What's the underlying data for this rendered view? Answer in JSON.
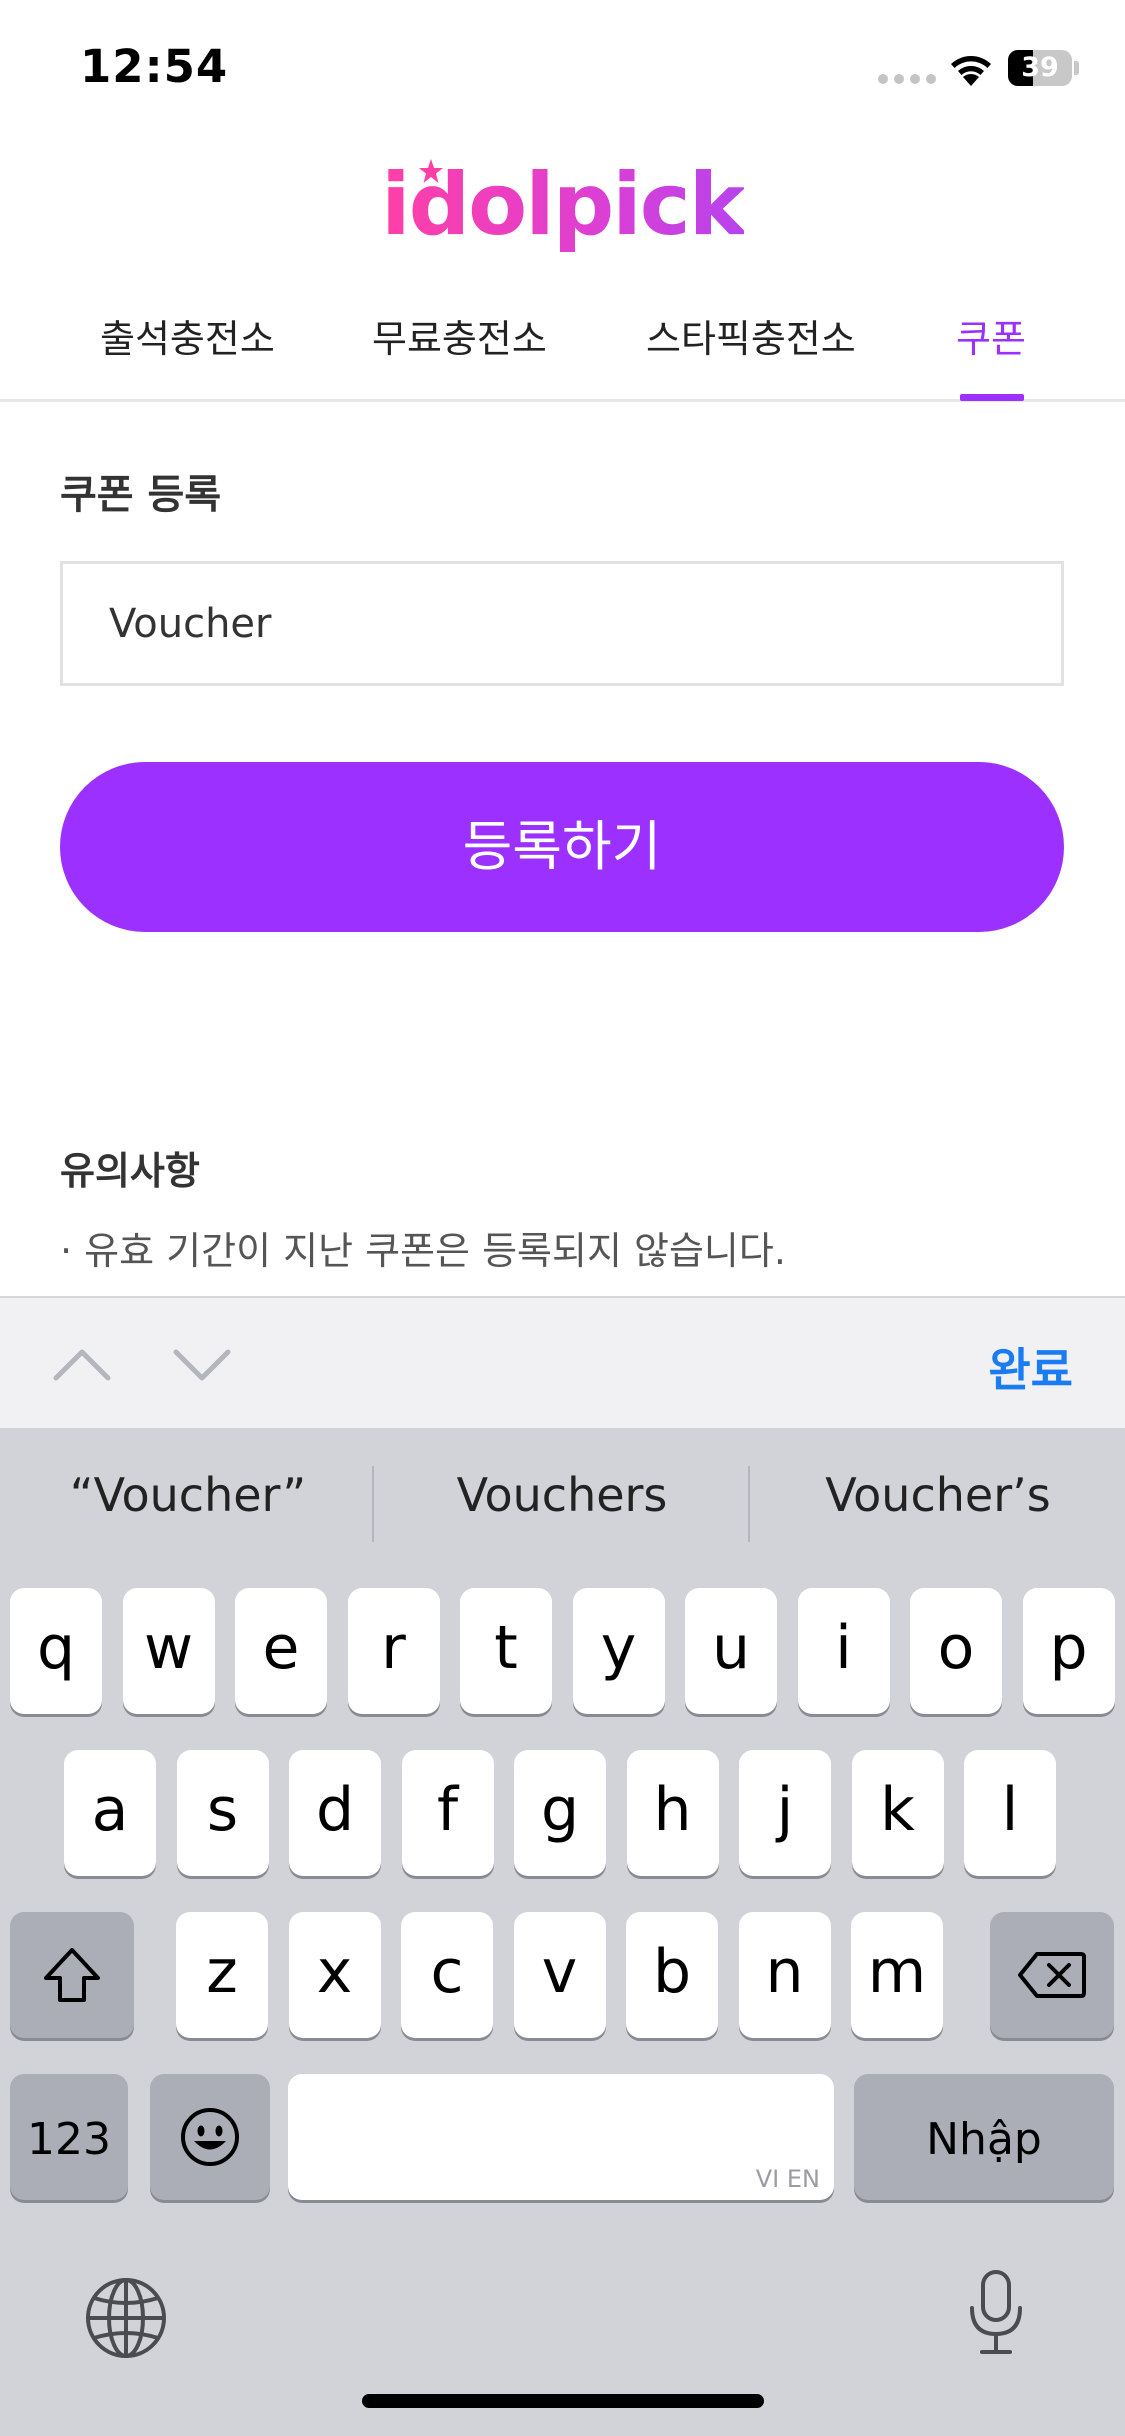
{
  "status_bar": {
    "time": "12:54",
    "battery_level": 39,
    "battery_text": "39"
  },
  "logo": {
    "text": "idolpick"
  },
  "tabs": [
    {
      "label": "출석충전소",
      "active": false
    },
    {
      "label": "무료충전소",
      "active": false
    },
    {
      "label": "스타픽충전소",
      "active": false
    },
    {
      "label": "쿠폰",
      "active": true
    }
  ],
  "coupon": {
    "title": "쿠폰 등록",
    "input_value": "Voucher",
    "submit_label": "등록하기"
  },
  "notes": {
    "title": "유의사항",
    "items": [
      "· 유효 기간이 지난 쿠폰은 등록되지 않습니다."
    ]
  },
  "accessory_bar": {
    "done_label": "완료"
  },
  "keyboard": {
    "suggestions": [
      "“Voucher”",
      "Vouchers",
      "Voucher’s"
    ],
    "row1": [
      "q",
      "w",
      "e",
      "r",
      "t",
      "y",
      "u",
      "i",
      "o",
      "p"
    ],
    "row2": [
      "a",
      "s",
      "d",
      "f",
      "g",
      "h",
      "j",
      "k",
      "l"
    ],
    "row3": [
      "z",
      "x",
      "c",
      "v",
      "b",
      "n",
      "m"
    ],
    "numbers_label": "123",
    "space_hint": "VI EN",
    "return_label": "Nhập"
  },
  "colors": {
    "accent": "#9b30ff",
    "done_blue": "#1a7cf0",
    "keyboard_bg": "#d1d3d9"
  }
}
